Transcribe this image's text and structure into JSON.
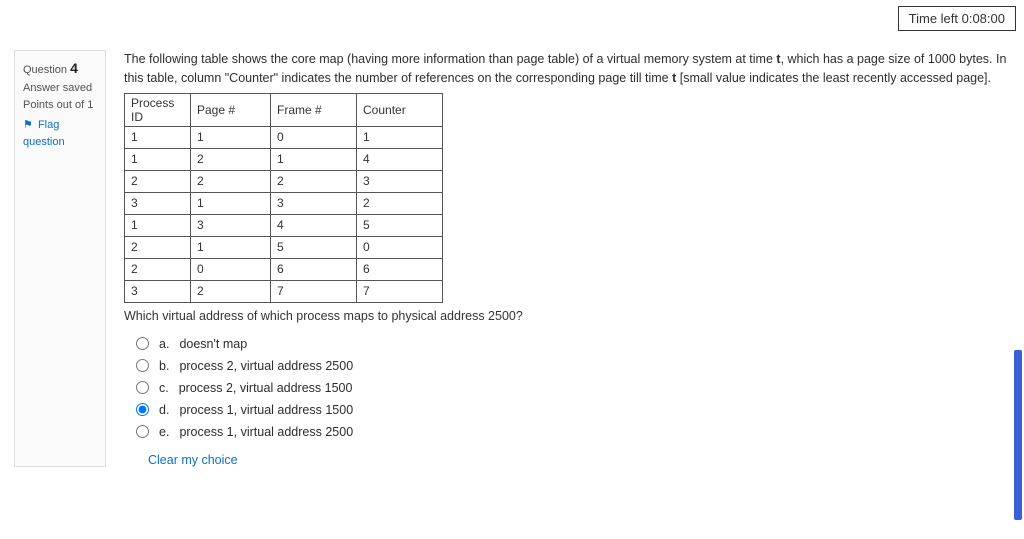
{
  "timer": {
    "text": "Time left 0:08:00"
  },
  "sidebar": {
    "question_label": "Question",
    "question_number": "4",
    "status": "Answer saved",
    "points": "Points out of 1",
    "flag_label": "Flag question"
  },
  "question": {
    "intro_1": "The following table shows the core map (having more information than page table) of a virtual memory system at time ",
    "intro_bold_1": "t",
    "intro_2": ", which has a page size of 1000 bytes. In this table, column \"Counter\" indicates the number of references on the corresponding page till time ",
    "intro_bold_2": "t",
    "intro_3": " [small value indicates the least recently accessed page].",
    "table": {
      "headers": [
        "Process ID",
        "Page #",
        "Frame #",
        "Counter"
      ],
      "rows": [
        [
          "1",
          "1",
          "0",
          "1"
        ],
        [
          "1",
          "2",
          "1",
          "4"
        ],
        [
          "2",
          "2",
          "2",
          "3"
        ],
        [
          "3",
          "1",
          "3",
          "2"
        ],
        [
          "1",
          "3",
          "4",
          "5"
        ],
        [
          "2",
          "1",
          "5",
          "0"
        ],
        [
          "2",
          "0",
          "6",
          "6"
        ],
        [
          "3",
          "2",
          "7",
          "7"
        ]
      ]
    },
    "subq": "Which virtual address of which process maps to physical address 2500?"
  },
  "options": [
    {
      "letter": "a.",
      "text": "doesn't map",
      "selected": false
    },
    {
      "letter": "b.",
      "text": "process 2, virtual address 2500",
      "selected": false
    },
    {
      "letter": "c.",
      "text": "process 2, virtual address 1500",
      "selected": false
    },
    {
      "letter": "d.",
      "text": "process 1, virtual address 1500",
      "selected": true
    },
    {
      "letter": "e.",
      "text": "process 1, virtual address 2500",
      "selected": false
    }
  ],
  "clear_label": "Clear my choice"
}
